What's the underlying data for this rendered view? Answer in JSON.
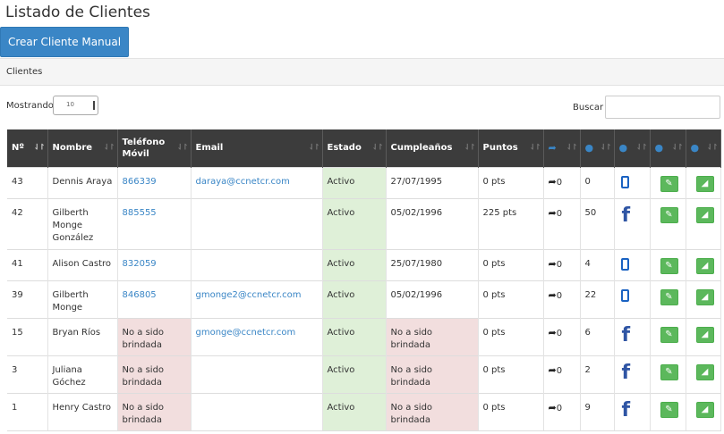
{
  "page_title": "Listado de Clientes",
  "create_button_label": "Crear Cliente Manual",
  "panel_heading": "Clientes",
  "length": {
    "label": "Mostrando",
    "value": "10"
  },
  "search": {
    "label": "Buscar",
    "value": ""
  },
  "columns": {
    "num": "Nº",
    "nombre": "Nombre",
    "telefono_1": "Teléfono",
    "telefono_2": "Móvil",
    "email": "Email",
    "estado": "Estado",
    "cumpleanos": "Cumpleaños",
    "puntos": "Puntos"
  },
  "icons": {
    "share": "share-arrow",
    "info": "info-circle",
    "phone": "mobile-phone",
    "facebook": "facebook",
    "edit": "pencil",
    "erase": "eraser",
    "sort": "sort-arrows"
  },
  "colors": {
    "primary": "#3a86c6",
    "success": "#5cb85c",
    "estado_bg": "#dff0d8",
    "missing_bg": "#f2dede",
    "header_bg": "#3c3c3c"
  },
  "rows": [
    {
      "num": "43",
      "nombre": "Dennis Araya",
      "telefono": "866339",
      "email": "daraya@ccnetcr.com",
      "estado": "Activo",
      "cumpleanos": "27/07/1995",
      "puntos": "0 pts",
      "shares": "0",
      "count": "0",
      "source": "phone"
    },
    {
      "num": "42",
      "nombre": "Gilberth Monge González",
      "telefono": "885555",
      "email": "",
      "estado": "Activo",
      "cumpleanos": "05/02/1996",
      "puntos": "225 pts",
      "shares": "0",
      "count": "50",
      "source": "facebook"
    },
    {
      "num": "41",
      "nombre": "Alison Castro",
      "telefono": "832059",
      "email": "",
      "estado": "Activo",
      "cumpleanos": "25/07/1980",
      "puntos": "0 pts",
      "shares": "0",
      "count": "4",
      "source": "phone"
    },
    {
      "num": "39",
      "nombre": "Gilberth Monge",
      "telefono": "846805",
      "email": "gmonge2@ccnetcr.com",
      "estado": "Activo",
      "cumpleanos": "05/02/1996",
      "puntos": "0 pts",
      "shares": "0",
      "count": "22",
      "source": "phone"
    },
    {
      "num": "15",
      "nombre": "Bryan Ríos",
      "telefono": "No a sido brindada",
      "email": "gmonge@ccnetcr.com",
      "estado": "Activo",
      "cumpleanos": "No a sido brindada",
      "puntos": "0 pts",
      "shares": "0",
      "count": "6",
      "source": "facebook"
    },
    {
      "num": "3",
      "nombre": "Juliana Góchez",
      "telefono": "No a sido brindada",
      "email": "",
      "estado": "Activo",
      "cumpleanos": "No a sido brindada",
      "puntos": "0 pts",
      "shares": "0",
      "count": "2",
      "source": "facebook"
    },
    {
      "num": "1",
      "nombre": "Henry Castro",
      "telefono": "No a sido brindada",
      "email": "",
      "estado": "Activo",
      "cumpleanos": "No a sido brindada",
      "puntos": "0 pts",
      "shares": "0",
      "count": "9",
      "source": "facebook"
    }
  ]
}
